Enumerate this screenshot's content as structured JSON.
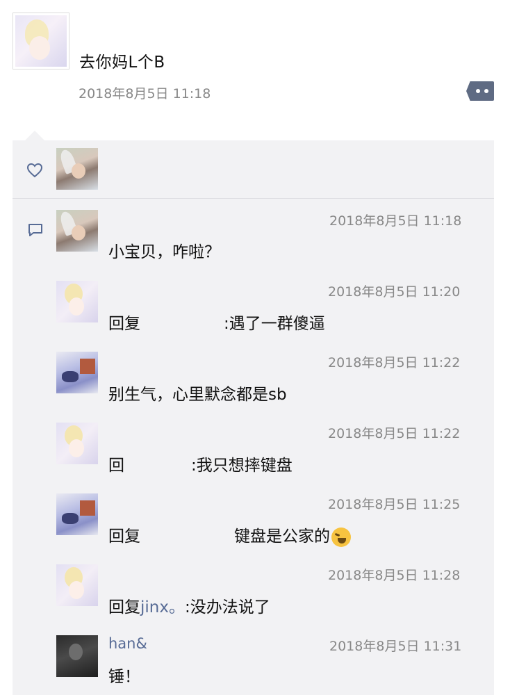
{
  "post": {
    "text": "去你妈L个B",
    "time": "2018年8月5日 11:18"
  },
  "icons": {
    "more": "more-dots-icon",
    "like": "heart-icon",
    "comment": "comment-icon"
  },
  "comments": [
    {
      "time": "2018年8月5日 11:18",
      "text": "小宝贝，咋啦？"
    },
    {
      "time": "2018年8月5日 11:20",
      "reply_prefix": "回复",
      "text": ":遇了一群傻逼"
    },
    {
      "time": "2018年8月5日 11:22",
      "text": "别生气，心里默念都是sb"
    },
    {
      "time": "2018年8月5日 11:22",
      "reply_prefix": "回",
      "text": ":我只想摔键盘"
    },
    {
      "time": "2018年8月5日 11:25",
      "reply_prefix": "回复",
      "text": "键盘是公家的"
    },
    {
      "time": "2018年8月5日 11:28",
      "reply_prefix": "回复",
      "reply_target": "jinx。",
      "text": ":没办法说了"
    },
    {
      "name": "han&",
      "time": "2018年8月5日 11:31",
      "text": "锤！"
    }
  ],
  "colors": {
    "link": "#576b95",
    "panel_bg": "#f2f2f4",
    "time_text": "#888888",
    "more_button": "#5f6b83"
  }
}
